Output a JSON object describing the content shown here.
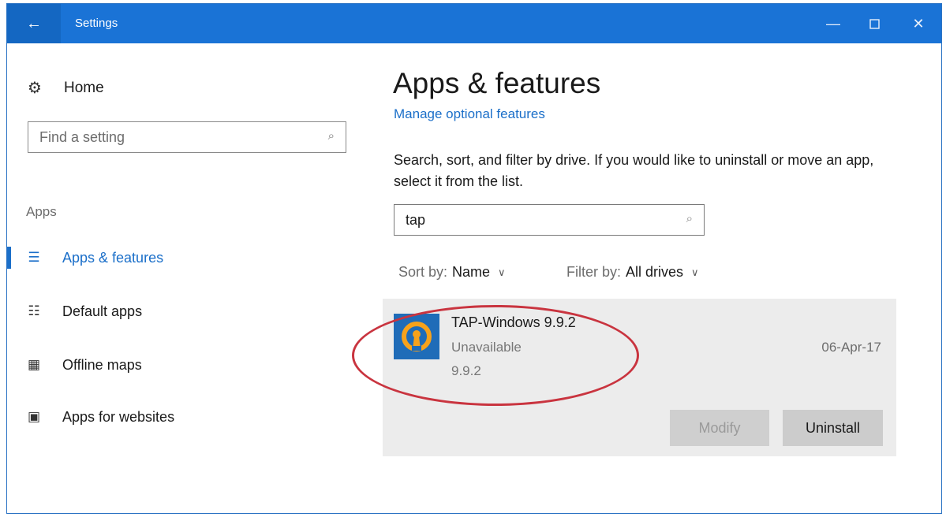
{
  "window": {
    "title": "Settings",
    "back_icon": "back-arrow-icon",
    "controls": [
      "minimize-icon",
      "maximize-icon",
      "close-icon"
    ]
  },
  "sidebar": {
    "home_label": "Home",
    "search_placeholder": "Find a setting",
    "group_label": "Apps",
    "items": [
      {
        "label": "Apps & features",
        "icon": "list-icon",
        "active": true
      },
      {
        "label": "Default apps",
        "icon": "default-apps-icon",
        "active": false
      },
      {
        "label": "Offline maps",
        "icon": "map-icon",
        "active": false
      },
      {
        "label": "Apps for websites",
        "icon": "website-icon",
        "active": false
      }
    ]
  },
  "main": {
    "title": "Apps & features",
    "optional_link": "Manage optional features",
    "description": "Search, sort, and filter by drive. If you would like to uninstall or move an app, select it from the list.",
    "search_value": "tap",
    "sort_label": "Sort by:",
    "sort_value": "Name",
    "filter_label": "Filter by:",
    "filter_value": "All drives",
    "app": {
      "name": "TAP-Windows 9.9.2",
      "status": "Unavailable",
      "version": "9.9.2",
      "date": "06-Apr-17",
      "icon": "openvpn-icon",
      "modify_label": "Modify",
      "uninstall_label": "Uninstall"
    }
  },
  "colors": {
    "titlebar": "#1a73d6",
    "accent": "#1b6fc9",
    "highlight": "#c9343f"
  }
}
